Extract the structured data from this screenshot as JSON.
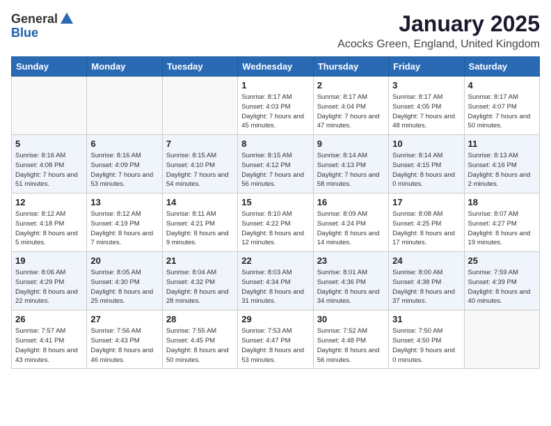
{
  "logo": {
    "text_general": "General",
    "text_blue": "Blue"
  },
  "title": "January 2025",
  "subtitle": "Acocks Green, England, United Kingdom",
  "days_of_week": [
    "Sunday",
    "Monday",
    "Tuesday",
    "Wednesday",
    "Thursday",
    "Friday",
    "Saturday"
  ],
  "weeks": [
    [
      {
        "day": "",
        "empty": true
      },
      {
        "day": "",
        "empty": true
      },
      {
        "day": "",
        "empty": true
      },
      {
        "day": "1",
        "sunrise": "8:17 AM",
        "sunset": "4:03 PM",
        "daylight": "7 hours and 45 minutes."
      },
      {
        "day": "2",
        "sunrise": "8:17 AM",
        "sunset": "4:04 PM",
        "daylight": "7 hours and 47 minutes."
      },
      {
        "day": "3",
        "sunrise": "8:17 AM",
        "sunset": "4:05 PM",
        "daylight": "7 hours and 48 minutes."
      },
      {
        "day": "4",
        "sunrise": "8:17 AM",
        "sunset": "4:07 PM",
        "daylight": "7 hours and 50 minutes."
      }
    ],
    [
      {
        "day": "5",
        "sunrise": "8:16 AM",
        "sunset": "4:08 PM",
        "daylight": "7 hours and 51 minutes."
      },
      {
        "day": "6",
        "sunrise": "8:16 AM",
        "sunset": "4:09 PM",
        "daylight": "7 hours and 53 minutes."
      },
      {
        "day": "7",
        "sunrise": "8:15 AM",
        "sunset": "4:10 PM",
        "daylight": "7 hours and 54 minutes."
      },
      {
        "day": "8",
        "sunrise": "8:15 AM",
        "sunset": "4:12 PM",
        "daylight": "7 hours and 56 minutes."
      },
      {
        "day": "9",
        "sunrise": "8:14 AM",
        "sunset": "4:13 PM",
        "daylight": "7 hours and 58 minutes."
      },
      {
        "day": "10",
        "sunrise": "8:14 AM",
        "sunset": "4:15 PM",
        "daylight": "8 hours and 0 minutes."
      },
      {
        "day": "11",
        "sunrise": "8:13 AM",
        "sunset": "4:16 PM",
        "daylight": "8 hours and 2 minutes."
      }
    ],
    [
      {
        "day": "12",
        "sunrise": "8:12 AM",
        "sunset": "4:18 PM",
        "daylight": "8 hours and 5 minutes."
      },
      {
        "day": "13",
        "sunrise": "8:12 AM",
        "sunset": "4:19 PM",
        "daylight": "8 hours and 7 minutes."
      },
      {
        "day": "14",
        "sunrise": "8:11 AM",
        "sunset": "4:21 PM",
        "daylight": "8 hours and 9 minutes."
      },
      {
        "day": "15",
        "sunrise": "8:10 AM",
        "sunset": "4:22 PM",
        "daylight": "8 hours and 12 minutes."
      },
      {
        "day": "16",
        "sunrise": "8:09 AM",
        "sunset": "4:24 PM",
        "daylight": "8 hours and 14 minutes."
      },
      {
        "day": "17",
        "sunrise": "8:08 AM",
        "sunset": "4:25 PM",
        "daylight": "8 hours and 17 minutes."
      },
      {
        "day": "18",
        "sunrise": "8:07 AM",
        "sunset": "4:27 PM",
        "daylight": "8 hours and 19 minutes."
      }
    ],
    [
      {
        "day": "19",
        "sunrise": "8:06 AM",
        "sunset": "4:29 PM",
        "daylight": "8 hours and 22 minutes."
      },
      {
        "day": "20",
        "sunrise": "8:05 AM",
        "sunset": "4:30 PM",
        "daylight": "8 hours and 25 minutes."
      },
      {
        "day": "21",
        "sunrise": "8:04 AM",
        "sunset": "4:32 PM",
        "daylight": "8 hours and 28 minutes."
      },
      {
        "day": "22",
        "sunrise": "8:03 AM",
        "sunset": "4:34 PM",
        "daylight": "8 hours and 31 minutes."
      },
      {
        "day": "23",
        "sunrise": "8:01 AM",
        "sunset": "4:36 PM",
        "daylight": "8 hours and 34 minutes."
      },
      {
        "day": "24",
        "sunrise": "8:00 AM",
        "sunset": "4:38 PM",
        "daylight": "8 hours and 37 minutes."
      },
      {
        "day": "25",
        "sunrise": "7:59 AM",
        "sunset": "4:39 PM",
        "daylight": "8 hours and 40 minutes."
      }
    ],
    [
      {
        "day": "26",
        "sunrise": "7:57 AM",
        "sunset": "4:41 PM",
        "daylight": "8 hours and 43 minutes."
      },
      {
        "day": "27",
        "sunrise": "7:56 AM",
        "sunset": "4:43 PM",
        "daylight": "8 hours and 46 minutes."
      },
      {
        "day": "28",
        "sunrise": "7:55 AM",
        "sunset": "4:45 PM",
        "daylight": "8 hours and 50 minutes."
      },
      {
        "day": "29",
        "sunrise": "7:53 AM",
        "sunset": "4:47 PM",
        "daylight": "8 hours and 53 minutes."
      },
      {
        "day": "30",
        "sunrise": "7:52 AM",
        "sunset": "4:48 PM",
        "daylight": "8 hours and 56 minutes."
      },
      {
        "day": "31",
        "sunrise": "7:50 AM",
        "sunset": "4:50 PM",
        "daylight": "9 hours and 0 minutes."
      },
      {
        "day": "",
        "empty": true
      }
    ]
  ]
}
